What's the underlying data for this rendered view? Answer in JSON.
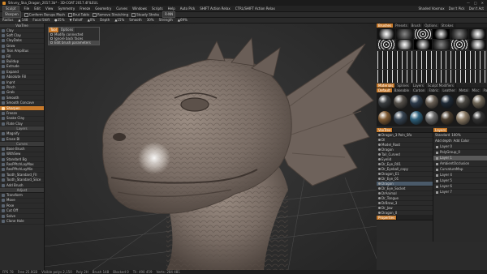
{
  "window": {
    "title": "Srkvny_Ska_Dragon_2017.3b* - 3D-COAT 2017.4FILEUL",
    "controls": [
      "—",
      "□",
      "✕"
    ]
  },
  "menubar": {
    "room": "Sculpt",
    "items": [
      "File",
      "Edit",
      "View",
      "Symmetry",
      "Freeze",
      "Geometry",
      "Curves",
      "Windows",
      "Scripts",
      "Help"
    ],
    "mode": "Auto Pick",
    "hint1": "SHIFT Action Relax",
    "hint2": "CTRL/SHIFT Action Relax",
    "right": [
      "Shaded Voxmax",
      "Don't Pick",
      "Don't Act"
    ]
  },
  "toolbar": {
    "items": [
      "Sharpen",
      "Conform Berups Mesh",
      "Brut Tablo",
      "Remove Stretching",
      "Steady Stroke",
      "R-NN"
    ]
  },
  "toolbar2": {
    "items": [
      "Radius",
      "▲ 148",
      "Focal Shift",
      "●35%",
      "▼ Falloff",
      "▲0%",
      "Depth",
      "▲15%",
      "Smooth",
      "30%",
      "Strength",
      "▲69%"
    ]
  },
  "sidebar": {
    "header": "VoxTree",
    "tools": [
      "Clay",
      "Soft Clay",
      "ClayDabs",
      "Grow",
      "Tron Amplitus",
      "Fill",
      "Buildup",
      "Extrude",
      "Expand",
      "Absolute Fill",
      "Inpnt",
      "Pinch",
      "Grab",
      "Smooth",
      "Smooth Concave",
      "Sharpen",
      "Freeze",
      "Snake Clay",
      "Flate Clay"
    ],
    "active_index": 15,
    "section1": "Layers",
    "tools2": [
      "Magnify",
      "Erase Bl"
    ],
    "section2": "Curves",
    "tools3": [
      "Base Brush",
      "WithSew",
      "Standard Bg",
      "ResPPtchLayMax",
      "ResPPtchLayMin",
      "Tooth_Standard_Fll",
      "Tooth_Standard_Slice",
      "Add Brush"
    ],
    "section3": "Adjust",
    "tools4": [
      "Transform",
      "Move",
      "Pose",
      "Cut Off",
      "Solve",
      "Clone Hole"
    ]
  },
  "tool_options": {
    "tabs": [
      "Tool",
      "Options"
    ],
    "rows": [
      "Modify connected",
      "Ignore back faces",
      "Edit brush parameters"
    ],
    "selected_index": 2
  },
  "right_panel": {
    "top_tabs": [
      "Brushes",
      "Presets",
      "Brush",
      "Options",
      "Strokes"
    ],
    "active_top": 0,
    "mat_tabs": [
      "Materials",
      "Splines",
      "Layers",
      "Sculpt Modifiers"
    ],
    "active_mat": 0,
    "mat_sub": [
      "Default",
      "Bakeable",
      "Carbon",
      "Fabric",
      "Leather",
      "Metal",
      "Misc",
      "Paint",
      "Polishes",
      "Textile",
      "Stone",
      "Volume"
    ],
    "mat_colors": [
      "#3a3d40",
      "#55504a",
      "#2c3a4a",
      "#6a6055",
      "#1f2a36",
      "#4b4842",
      "#6d6455",
      "#7e5a34",
      "#374452",
      "#2d5f7a",
      "#6a6a6a",
      "#4a3d2e",
      "#8a7a65",
      "#333"
    ],
    "scene": {
      "title": "VoxTree",
      "rows": [
        "Dragon_3 Poln_Sfa",
        "Dl",
        "Model_Root",
        "Dragon",
        "Tail_Curved",
        "Eyelid",
        "Dr_Eye_R01",
        "Dr_Eyeball_copy",
        "Dragon_E1",
        "Dr_Eye_01",
        "Dragon",
        "Dr_Eye_Socket",
        "DrAnimal",
        "Dr_Tongue",
        "DrBrow_3",
        "Dr_Jaw",
        "Dragon_0"
      ],
      "selected_index": 10,
      "footer": "Properties"
    },
    "layers": {
      "tab": "Layers",
      "blend": "Standard",
      "opacity": "100%",
      "opts": [
        "Add depth",
        "Add Color"
      ],
      "rows": [
        "Layer 0",
        "PolyGroup_0",
        "Layer 1",
        "AmbientOcclusion",
        "CurvatureMap",
        "Layer 4",
        "Layer 5",
        "Layer 6",
        "Layer 7"
      ],
      "selected_index": 2
    }
  },
  "statusbar": {
    "items": [
      "FPS 78",
      "Free 25.0GB",
      "Visible polys 2,150",
      "Poly 2H",
      "Brush 148",
      "Blocked 0",
      "Tri: 490 459",
      "Verts: 284 481"
    ]
  },
  "colors": {
    "accent": "#c87a2b",
    "background": "#2e2e2e",
    "model": "#7b6e66"
  }
}
